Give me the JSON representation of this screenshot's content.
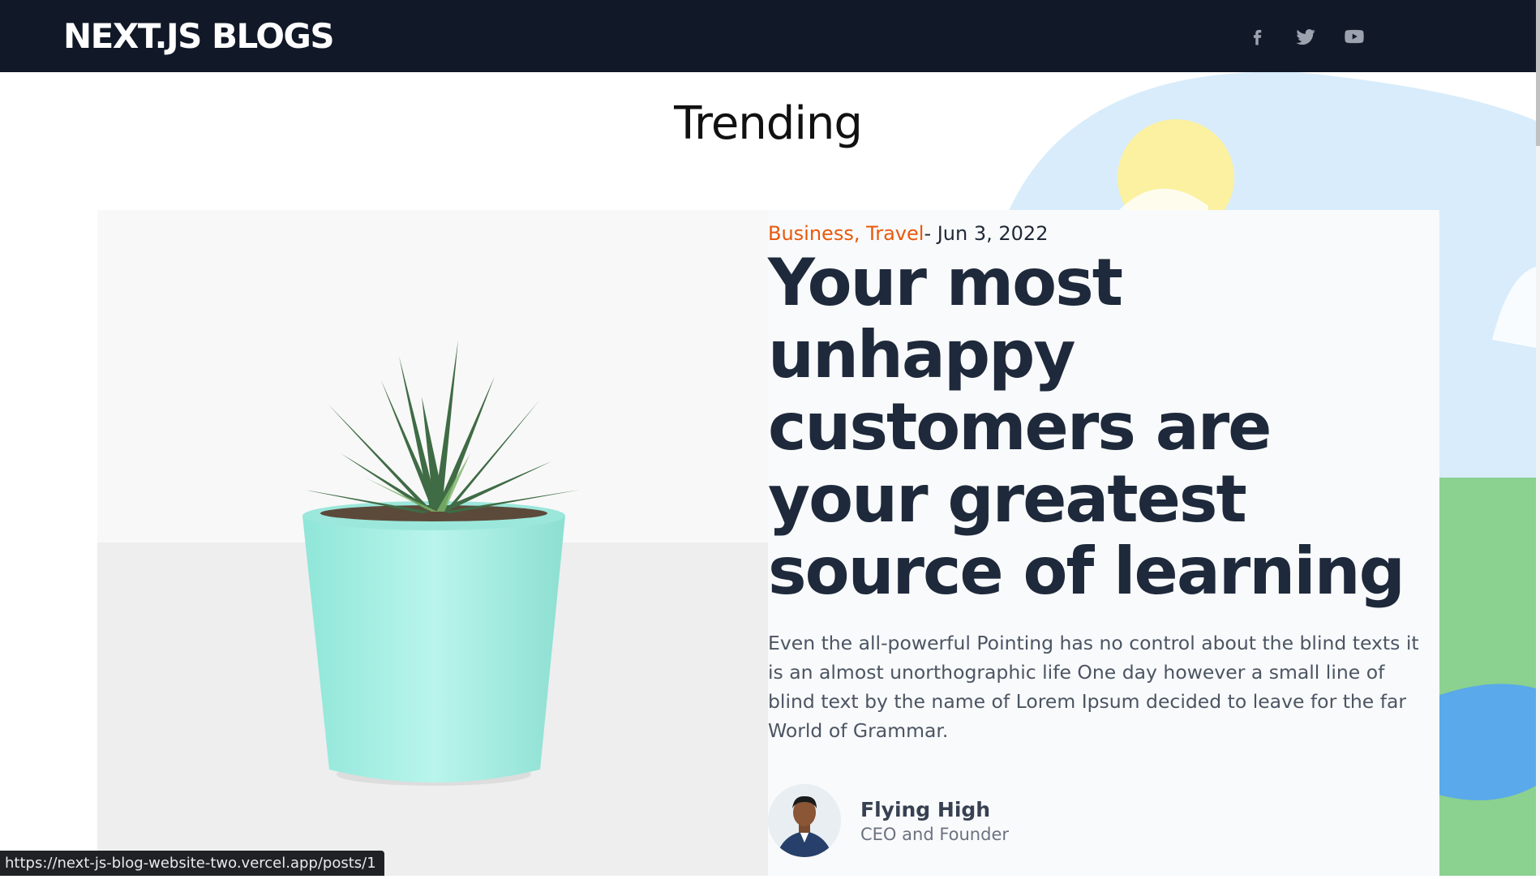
{
  "navbar": {
    "brand": "NEXT.JS BLOGS",
    "socials": [
      {
        "icon": "facebook-icon"
      },
      {
        "icon": "twitter-icon"
      },
      {
        "icon": "youtube-icon"
      }
    ]
  },
  "section": {
    "title": "Trending"
  },
  "post": {
    "categories": "Business, Travel",
    "date": "- Jun 3, 2022",
    "title": "Your most unhappy customers are your greatest source of learning",
    "excerpt": "Even the all-powerful Pointing has no control about the blind texts it is an almost unorthographic life One day however a small line of blind text by the name of Lorem Ipsum decided to leave for the far World of Grammar.",
    "author": {
      "name": "Flying High",
      "role": "CEO and Founder"
    }
  },
  "status_bar": {
    "url": "https://next-js-blog-website-two.vercel.app/posts/1"
  },
  "colors": {
    "navbar_bg": "#111827",
    "accent": "#ea580c",
    "title": "#1e293b",
    "card_bg": "#f9fafb"
  }
}
